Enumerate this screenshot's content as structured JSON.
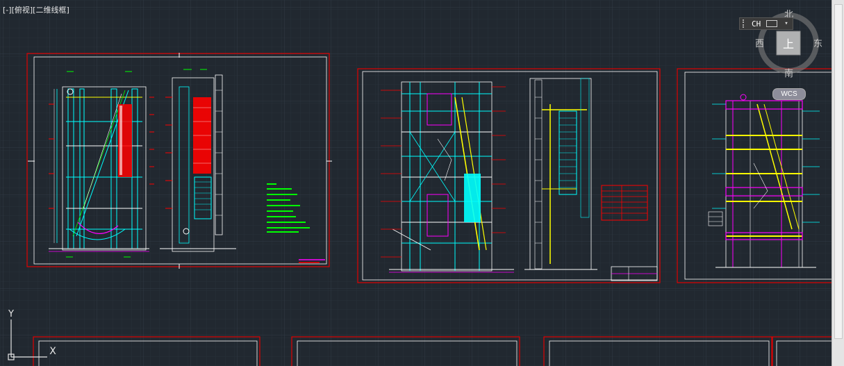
{
  "viewport": {
    "controls_label_parts": [
      "[-]",
      "[俯视]",
      "[二维线框]"
    ]
  },
  "viewcube": {
    "north": "北",
    "south": "南",
    "east": "东",
    "west": "西",
    "face": "上",
    "wcs_label": "WCS"
  },
  "ime_bar": {
    "language": "CH"
  },
  "ucs_icon": {
    "x_label": "X",
    "y_label": "Y"
  },
  "colors": {
    "background": "#212830",
    "sheet_border": "#e00000",
    "white": "#ffffff",
    "cyan": "#00ffff",
    "green": "#00ff00",
    "yellow": "#ffff00",
    "magenta": "#ff00ff",
    "red": "#ff0000"
  }
}
